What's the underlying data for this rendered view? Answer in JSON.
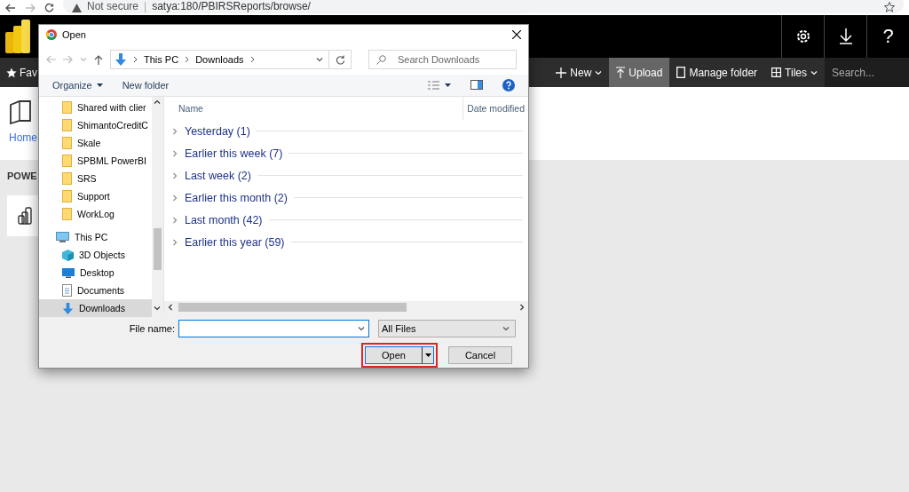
{
  "browser": {
    "security": "Not secure",
    "separator": "|",
    "url": "satya:180/PBIRSReports/browse/"
  },
  "header": {
    "help": "?"
  },
  "toolbar": {
    "favorites": "Fav",
    "search_placeholder": "Search...",
    "items": [
      {
        "label": "New",
        "kind": "new",
        "dropdown": true,
        "selected": false
      },
      {
        "label": "Upload",
        "kind": "upload",
        "dropdown": false,
        "selected": true
      },
      {
        "label": "Manage folder",
        "kind": "manage",
        "dropdown": false,
        "selected": false
      },
      {
        "label": "Tiles",
        "kind": "tiles",
        "dropdown": true,
        "selected": false
      }
    ]
  },
  "breadcrumb": "Home",
  "section_title": "POWE",
  "dialog": {
    "title": "Open",
    "address": [
      "This PC",
      "Downloads"
    ],
    "search_placeholder": "Search Downloads",
    "commands": [
      {
        "label": "Organize",
        "dropdown": true
      },
      {
        "label": "New folder",
        "dropdown": false
      }
    ],
    "nav": {
      "folders": [
        {
          "label": "Shared with clier",
          "selected": false
        },
        {
          "label": "ShimantoCreditC",
          "selected": false
        },
        {
          "label": "Skale",
          "selected": false
        },
        {
          "label": "SPBML PowerBI",
          "selected": false
        },
        {
          "label": "SRS",
          "selected": false
        },
        {
          "label": "Support",
          "selected": false
        },
        {
          "label": "WorkLog",
          "selected": false
        }
      ],
      "this_pc": {
        "label": "This PC",
        "selected": false,
        "children": [
          {
            "label": "3D Objects",
            "kind": "objects",
            "selected": false
          },
          {
            "label": "Desktop",
            "kind": "desktop",
            "selected": false
          },
          {
            "label": "Documents",
            "kind": "documents",
            "selected": false
          },
          {
            "label": "Downloads",
            "kind": "downloads",
            "selected": true
          }
        ]
      }
    },
    "columns": [
      "Name",
      "Date modified"
    ],
    "groups": [
      {
        "label": "Yesterday (1)",
        "expanded": false
      },
      {
        "label": "Earlier this week (7)",
        "expanded": false
      },
      {
        "label": "Last week (2)",
        "expanded": false
      },
      {
        "label": "Earlier this month (2)",
        "expanded": false
      },
      {
        "label": "Last month (42)",
        "expanded": false
      },
      {
        "label": "Earlier this year (59)",
        "expanded": false
      }
    ],
    "file_name_label": "File name:",
    "filter": "All Files",
    "buttons": [
      {
        "label": "Open",
        "kind": "primary",
        "highlighted": true
      },
      {
        "label": "Cancel",
        "kind": "secondary",
        "highlighted": false
      }
    ]
  }
}
